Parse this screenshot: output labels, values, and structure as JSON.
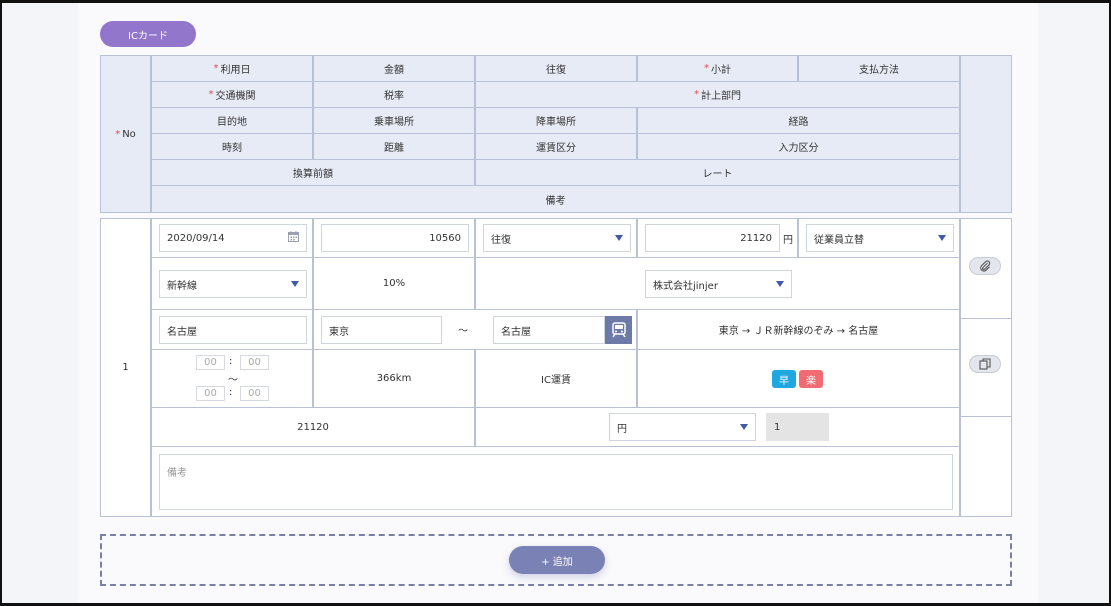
{
  "ic_card_button": "ICカード",
  "required_mark": "*",
  "header": {
    "no": "No",
    "date": "利用日",
    "amount": "金額",
    "round_trip": "往復",
    "subtotal": "小計",
    "payment_method": "支払方法",
    "transport": "交通機関",
    "tax_rate": "税率",
    "department": "計上部門",
    "destination": "目的地",
    "boarding": "乗車場所",
    "alighting": "降車場所",
    "route": "経路",
    "time": "時刻",
    "distance": "距離",
    "fare_type": "運賃区分",
    "input_type": "入力区分",
    "pre_conversion": "換算前額",
    "rate": "レート",
    "remarks": "備考"
  },
  "row": {
    "no": "1",
    "date": "2020/09/14",
    "amount": "10560",
    "round_trip": "往復",
    "subtotal": "21120",
    "yen_unit": "円",
    "payment_method": "従業員立替",
    "transport": "新幹線",
    "tax_rate": "10%",
    "department": "株式会社jinjer",
    "destination": "名古屋",
    "boarding": "東京",
    "tilde": "～",
    "alighting": "名古屋",
    "route": "東京 → ＪＲ新幹線のぞみ → 名古屋",
    "time_from_h": "00",
    "time_from_m": "00",
    "time_to_h": "00",
    "time_to_m": "00",
    "time_colon": ":",
    "distance": "366km",
    "fare_type": "IC運賃",
    "badge_fast": "早",
    "badge_easy": "楽",
    "pre_conversion": "21120",
    "currency": "円",
    "rate": "1",
    "remarks_placeholder": "備考"
  },
  "add_button": "+ 追加",
  "colors": {
    "accent_purple": "#9176cc",
    "add_button": "#7a82b5",
    "badge_fast": "#1fa7e0",
    "badge_easy": "#f26b73",
    "required": "#e34d4d",
    "header_bg": "#e6ebf5"
  },
  "icons": {
    "calendar": "calendar-icon",
    "train": "train-icon",
    "attach": "paperclip-icon",
    "copy": "copy-icon"
  }
}
